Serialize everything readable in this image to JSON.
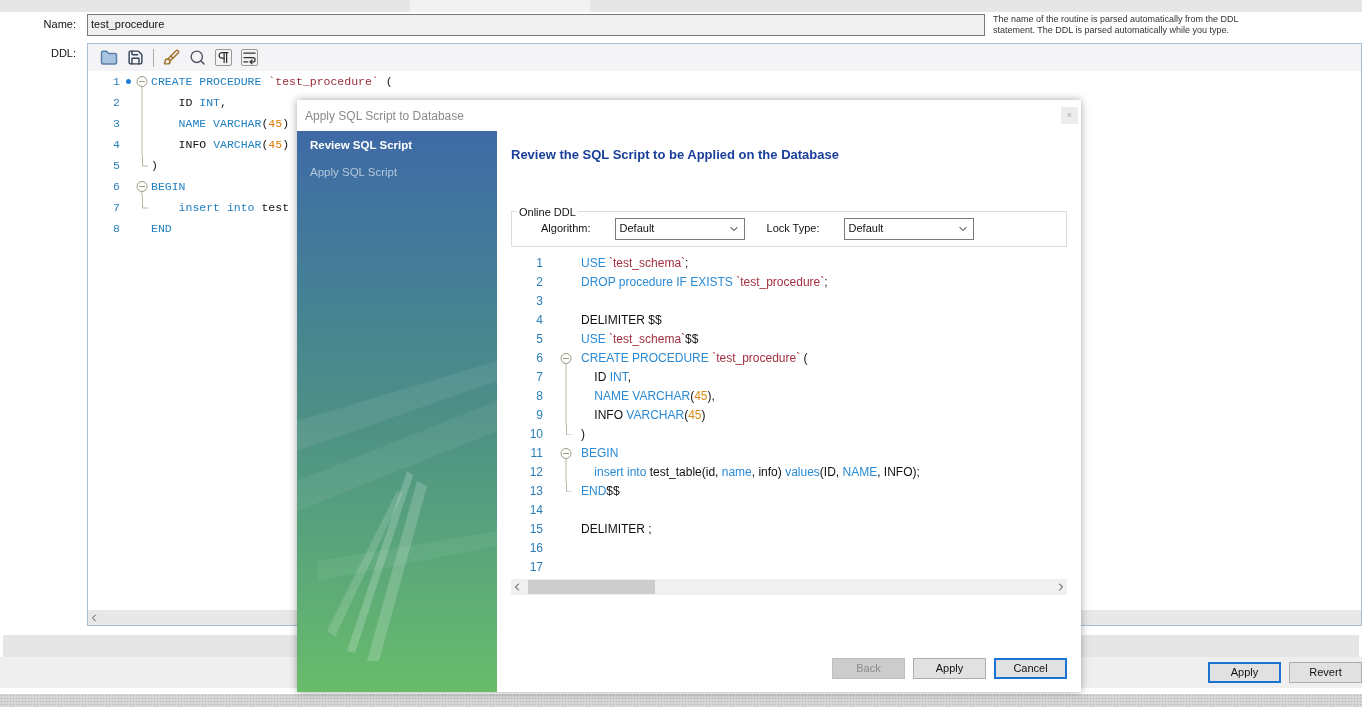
{
  "name_field": {
    "label": "Name:",
    "value": "test_procedure"
  },
  "hint": "The name of the routine is parsed automatically from the DDL statement. The DDL is parsed automatically while you type.",
  "ddl_label": "DDL:",
  "editor": {
    "lines": [
      {
        "number": "1",
        "dot": true,
        "kind": "fold-start",
        "tokens": [
          {
            "t": "CREATE PROCEDURE",
            "kind": "kw"
          },
          {
            "t": " `test_procedure`",
            "kind": "str"
          },
          {
            "t": " (",
            "kind": "plain"
          }
        ]
      },
      {
        "number": "2",
        "dot": false,
        "kind": "fold-inner",
        "tokens": [
          {
            "t": "    ID ",
            "kind": "plain"
          },
          {
            "t": "INT",
            "kind": "kw"
          },
          {
            "t": ",",
            "kind": "plain"
          }
        ]
      },
      {
        "number": "3",
        "dot": false,
        "kind": "fold-inner",
        "tokens": [
          {
            "t": "    NAME VARCHAR",
            "kind": "kw"
          },
          {
            "t": "(",
            "kind": "plain"
          },
          {
            "t": "45",
            "kind": "num"
          },
          {
            "t": ")",
            "kind": "plain"
          }
        ]
      },
      {
        "number": "4",
        "dot": false,
        "kind": "fold-inner",
        "tokens": [
          {
            "t": "    INFO ",
            "kind": "plain"
          },
          {
            "t": "VARCHAR",
            "kind": "kw"
          },
          {
            "t": "(",
            "kind": "plain"
          },
          {
            "t": "45",
            "kind": "num"
          },
          {
            "t": ")",
            "kind": "plain"
          }
        ]
      },
      {
        "number": "5",
        "dot": false,
        "kind": "fold-end",
        "tokens": [
          {
            "t": ")",
            "kind": "plain"
          }
        ]
      },
      {
        "number": "6",
        "dot": false,
        "kind": "fold-start",
        "tokens": [
          {
            "t": "BEGIN",
            "kind": "kw"
          }
        ]
      },
      {
        "number": "7",
        "dot": false,
        "kind": "fold-end",
        "tokens": [
          {
            "t": "    insert into",
            "kind": "kw"
          },
          {
            "t": " test",
            "kind": "plain"
          }
        ]
      },
      {
        "number": "8",
        "dot": false,
        "kind": "plain",
        "tokens": [
          {
            "t": "END",
            "kind": "kw"
          }
        ]
      }
    ]
  },
  "dialog": {
    "title": "Apply SQL Script to Database",
    "close": "×",
    "steps": [
      {
        "label": "Review SQL Script",
        "selected": true
      },
      {
        "label": "Apply SQL Script",
        "selected": false
      }
    ],
    "heading": "Review the SQL Script to be Applied on the Database",
    "online_ddl": {
      "legend": "Online DDL",
      "algorithm": {
        "label": "Algorithm:",
        "value": "Default"
      },
      "lock_type": {
        "label": "Lock Type:",
        "value": "Default"
      }
    },
    "script": {
      "lines": [
        {
          "number": "1",
          "kind": "plain",
          "tokens": [
            {
              "t": "USE",
              "kind": "kw"
            },
            {
              "t": " `test_schema`",
              "kind": "str"
            },
            {
              "t": ";",
              "kind": "plain"
            }
          ]
        },
        {
          "number": "2",
          "kind": "plain",
          "tokens": [
            {
              "t": "DROP procedure IF EXISTS",
              "kind": "kw"
            },
            {
              "t": " `test_procedure`",
              "kind": "str"
            },
            {
              "t": ";",
              "kind": "plain"
            }
          ]
        },
        {
          "number": "3",
          "kind": "plain"
        },
        {
          "number": "4",
          "kind": "plain",
          "tokens": [
            {
              "t": "DELIMITER $$",
              "kind": "plain"
            }
          ]
        },
        {
          "number": "5",
          "kind": "plain",
          "tokens": [
            {
              "t": "USE",
              "kind": "kw"
            },
            {
              "t": " `test_schema`",
              "kind": "str"
            },
            {
              "t": "$$",
              "kind": "plain"
            }
          ]
        },
        {
          "number": "6",
          "kind": "fold-start",
          "tokens": [
            {
              "t": "CREATE PROCEDURE",
              "kind": "kw"
            },
            {
              "t": " `test_procedure`",
              "kind": "str"
            },
            {
              "t": " (",
              "kind": "plain"
            }
          ]
        },
        {
          "number": "7",
          "kind": "fold-inner",
          "tokens": [
            {
              "t": "    ID ",
              "kind": "plain"
            },
            {
              "t": "INT",
              "kind": "kw"
            },
            {
              "t": ",",
              "kind": "plain"
            }
          ]
        },
        {
          "number": "8",
          "kind": "fold-inner",
          "tokens": [
            {
              "t": "    NAME VARCHAR",
              "kind": "kw"
            },
            {
              "t": "(",
              "kind": "plain"
            },
            {
              "t": "45",
              "kind": "num"
            },
            {
              "t": "),",
              "kind": "plain"
            }
          ]
        },
        {
          "number": "9",
          "kind": "fold-inner",
          "tokens": [
            {
              "t": "    INFO ",
              "kind": "plain"
            },
            {
              "t": "VARCHAR",
              "kind": "kw"
            },
            {
              "t": "(",
              "kind": "plain"
            },
            {
              "t": "45",
              "kind": "num"
            },
            {
              "t": ")",
              "kind": "plain"
            }
          ]
        },
        {
          "number": "10",
          "kind": "fold-end",
          "tokens": [
            {
              "t": ")",
              "kind": "plain"
            }
          ]
        },
        {
          "number": "11",
          "kind": "fold-start",
          "tokens": [
            {
              "t": "BEGIN",
              "kind": "kw"
            }
          ]
        },
        {
          "number": "12",
          "kind": "fold-inner",
          "tokens": [
            {
              "t": "    insert into",
              "kind": "kw"
            },
            {
              "t": " test_table(id, ",
              "kind": "plain"
            },
            {
              "t": "name",
              "kind": "kw"
            },
            {
              "t": ", info) ",
              "kind": "plain"
            },
            {
              "t": "values",
              "kind": "kw"
            },
            {
              "t": "(ID, ",
              "kind": "plain"
            },
            {
              "t": "NAME",
              "kind": "kw"
            },
            {
              "t": ", INFO);",
              "kind": "plain"
            }
          ]
        },
        {
          "number": "13",
          "kind": "fold-end",
          "tokens": [
            {
              "t": "END",
              "kind": "kw"
            },
            {
              "t": "$$",
              "kind": "plain"
            }
          ]
        },
        {
          "number": "14",
          "kind": "plain"
        },
        {
          "number": "15",
          "kind": "plain",
          "tokens": [
            {
              "t": "DELIMITER ;",
              "kind": "plain"
            }
          ]
        },
        {
          "number": "16",
          "kind": "plain"
        },
        {
          "number": "17",
          "kind": "plain"
        }
      ]
    },
    "buttons": [
      {
        "label": "Back",
        "disabled": true,
        "focused": false
      },
      {
        "label": "Apply",
        "disabled": false,
        "focused": false
      },
      {
        "label": "Cancel",
        "disabled": false,
        "focused": true
      }
    ]
  },
  "footer_buttons": [
    {
      "label": "Apply",
      "focused": true
    },
    {
      "label": "Revert",
      "focused": false
    }
  ]
}
